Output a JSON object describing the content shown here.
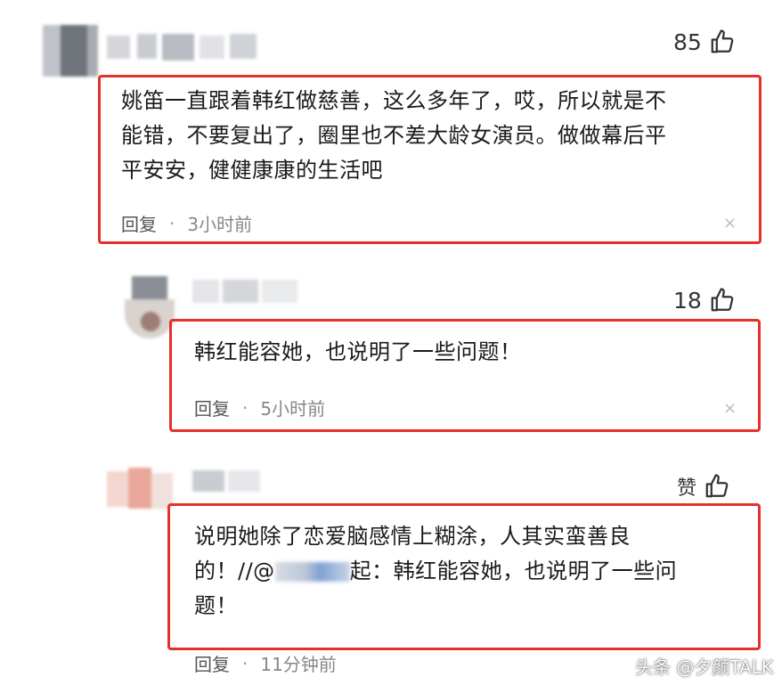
{
  "comments": [
    {
      "likes": "85",
      "text_lines": [
        "姚笛一直跟着韩红做慈善，这么多年了，哎，所以就是不",
        "能错，不要复出了，圈里也不差大龄女演员。做做幕后平",
        "平安安，健健康康的生活吧"
      ],
      "reply_label": "回复",
      "separator": "·",
      "time": "3小时前"
    },
    {
      "likes": "18",
      "text_lines": [
        "韩红能容她，也说明了一些问题！"
      ],
      "reply_label": "回复",
      "separator": "·",
      "time": "5小时前"
    },
    {
      "likes": "赞",
      "text_lines": [
        "说明她除了恋爱脑感情上糊涂，人其实蛮善良",
        "的！//@",
        "起：韩红能容她，也说明了一些问",
        "题！"
      ],
      "reply_label": "回复",
      "separator": "·",
      "time": "11分钟前"
    }
  ],
  "icons": {
    "like": "thumbs-up-icon",
    "close": "close-icon"
  },
  "close_glyph": "×",
  "watermark": "头条 @夕颜TALK",
  "colors": {
    "highlight_border": "#e5302c"
  }
}
